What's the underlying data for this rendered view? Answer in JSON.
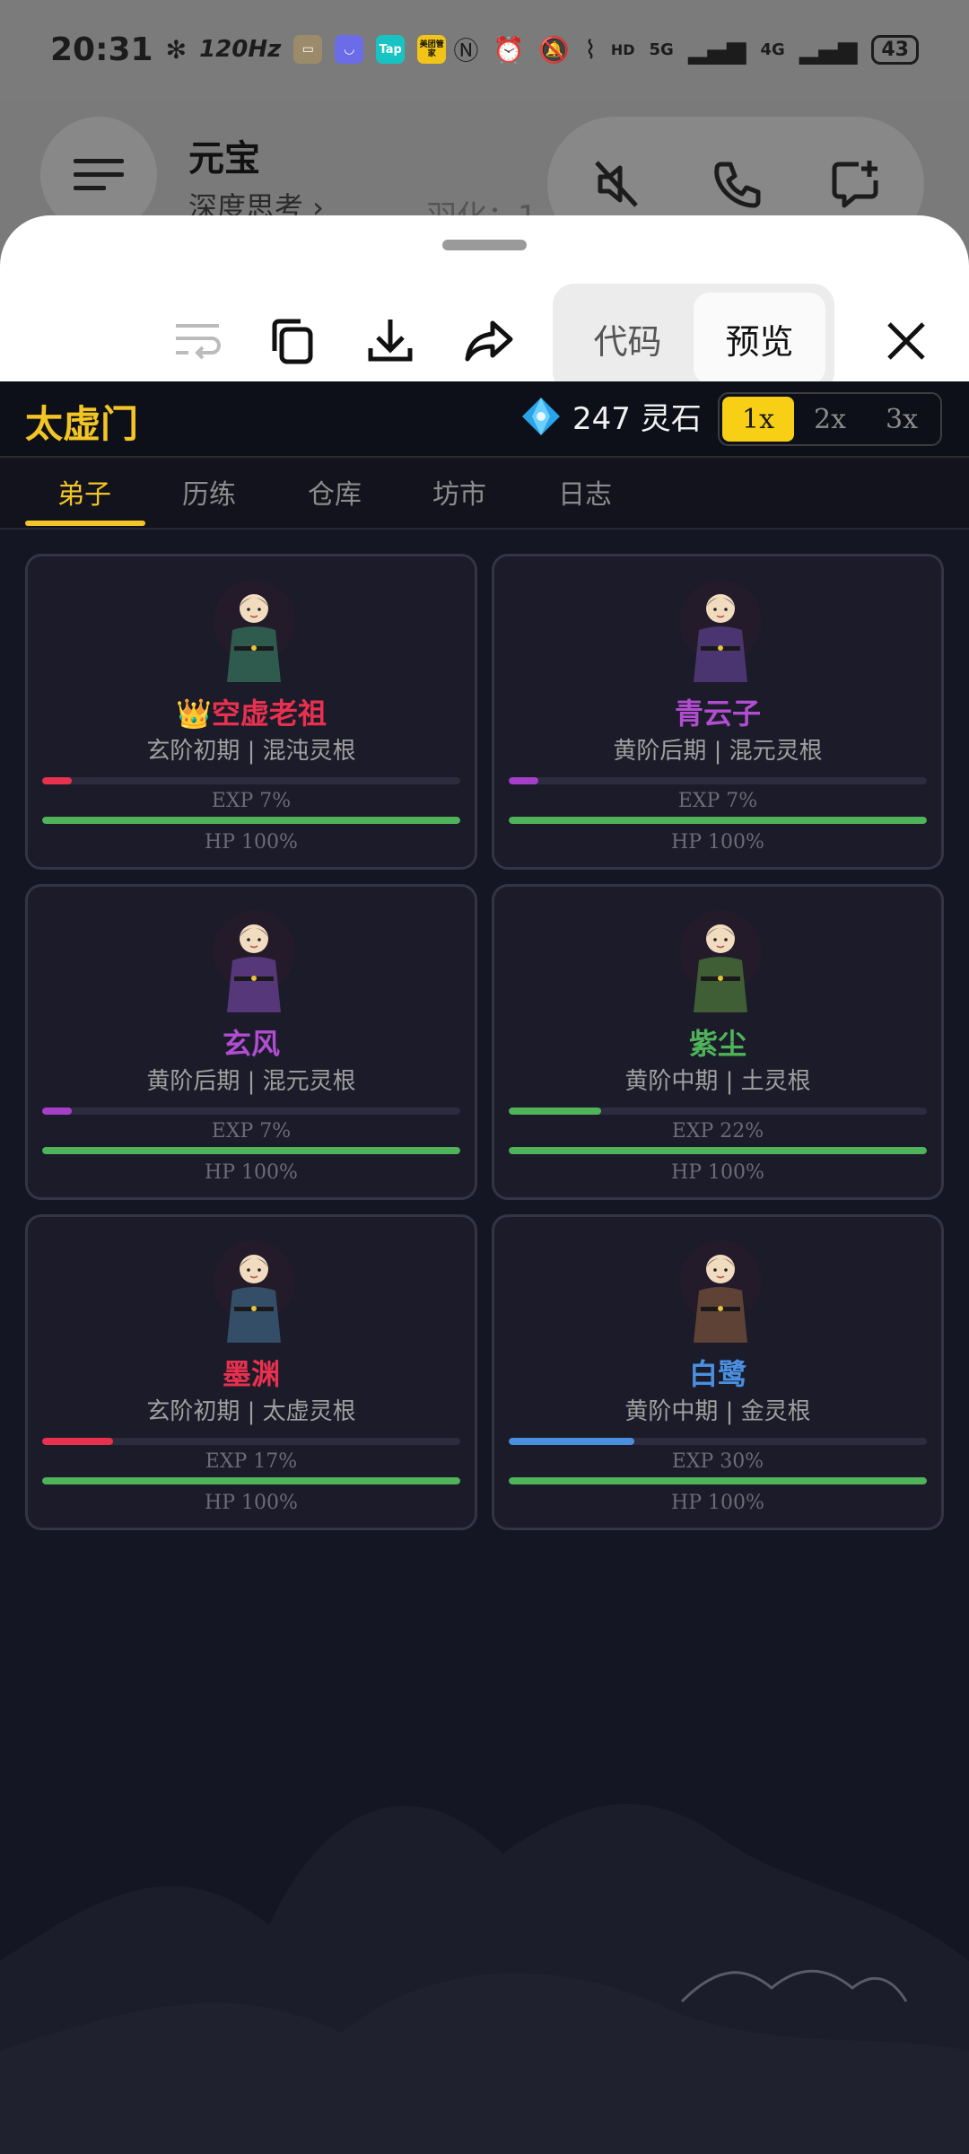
{
  "status_bar": {
    "time": "20:31",
    "refresh_rate": "120Hz",
    "app_chip_labels": [
      "Tap",
      "美团管家"
    ],
    "network": "5G",
    "network2": "4G",
    "battery": "43"
  },
  "background_chat": {
    "title": "元宝",
    "subtitle": "深度思考 ›",
    "ghost_text": "羽化：1"
  },
  "sheet_toolbar": {
    "segments": [
      "代码",
      "预览"
    ],
    "active_segment": "预览"
  },
  "game": {
    "sect_name": "太虚门",
    "currency_amount": "247 灵石",
    "speed_options": [
      "1x",
      "2x",
      "3x"
    ],
    "active_speed": "1x",
    "tabs": [
      "弟子",
      "历练",
      "仓库",
      "坊市",
      "日志"
    ],
    "active_tab": "弟子",
    "disciples": [
      {
        "name": "👑空虚老祖",
        "info": "玄阶初期 | 混沌灵根",
        "exp_label": "EXP 7%",
        "hp_label": "HP 100%",
        "exp": 0.07,
        "hp": 1.0,
        "name_color": "#e8304f",
        "exp_color": "#e8304f",
        "robe": "#2f5a4e"
      },
      {
        "name": "青云子",
        "info": "黄阶后期 | 混元灵根",
        "exp_label": "EXP 7%",
        "hp_label": "HP 100%",
        "exp": 0.07,
        "hp": 1.0,
        "name_color": "#b04dd0",
        "exp_color": "#a63fc8",
        "robe": "#4a3570"
      },
      {
        "name": "玄风",
        "info": "黄阶后期 | 混元灵根",
        "exp_label": "EXP 7%",
        "hp_label": "HP 100%",
        "exp": 0.07,
        "hp": 1.0,
        "name_color": "#b04dd0",
        "exp_color": "#a63fc8",
        "robe": "#55377a"
      },
      {
        "name": "紫尘",
        "info": "黄阶中期 | 土灵根",
        "exp_label": "EXP 22%",
        "hp_label": "HP 100%",
        "exp": 0.22,
        "hp": 1.0,
        "name_color": "#4fb35a",
        "exp_color": "#4fb35a",
        "robe": "#3f5e35"
      },
      {
        "name": "墨渊",
        "info": "玄阶初期 | 太虚灵根",
        "exp_label": "EXP 17%",
        "hp_label": "HP 100%",
        "exp": 0.17,
        "hp": 1.0,
        "name_color": "#e8304f",
        "exp_color": "#e8304f",
        "robe": "#344e68"
      },
      {
        "name": "白鹭",
        "info": "黄阶中期 | 金灵根",
        "exp_label": "EXP 30%",
        "hp_label": "HP 100%",
        "exp": 0.3,
        "hp": 1.0,
        "name_color": "#4a8fe0",
        "exp_color": "#4a8fe0",
        "robe": "#5e4236"
      }
    ],
    "colors": {
      "gold": "#f2c524",
      "hp": "#4fb35a",
      "bg": "#141623"
    }
  }
}
